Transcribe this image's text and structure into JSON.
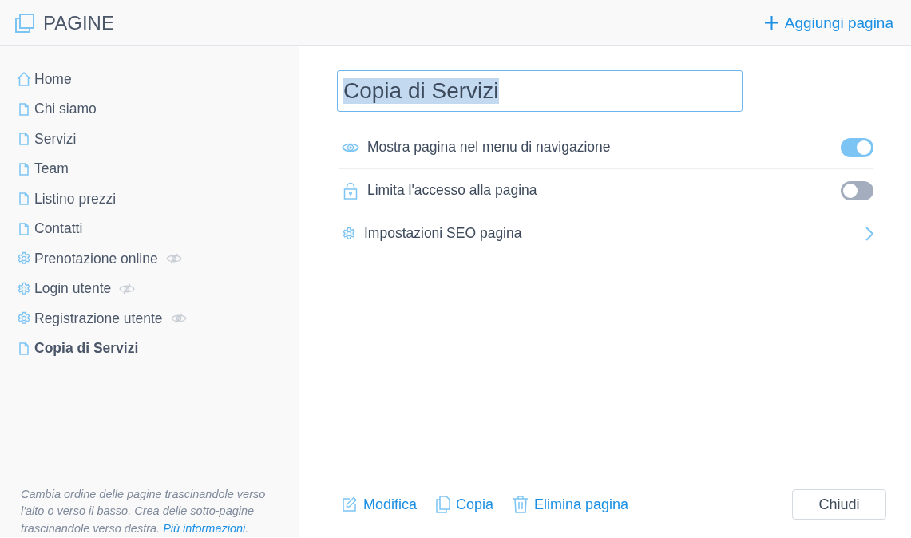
{
  "header": {
    "title": "PAGINE",
    "add_button": "Aggiungi pagina"
  },
  "sidebar": {
    "items": [
      {
        "label": "Home",
        "kind": "home",
        "hidden": false,
        "selected": false
      },
      {
        "label": "Chi siamo",
        "kind": "page",
        "hidden": false,
        "selected": false
      },
      {
        "label": "Servizi",
        "kind": "page",
        "hidden": false,
        "selected": false
      },
      {
        "label": "Team",
        "kind": "page",
        "hidden": false,
        "selected": false
      },
      {
        "label": "Listino prezzi",
        "kind": "page",
        "hidden": false,
        "selected": false
      },
      {
        "label": "Contatti",
        "kind": "page",
        "hidden": false,
        "selected": false
      },
      {
        "label": "Prenotazione online",
        "kind": "system",
        "hidden": true,
        "selected": false
      },
      {
        "label": "Login utente",
        "kind": "system",
        "hidden": true,
        "selected": false
      },
      {
        "label": "Registrazione utente",
        "kind": "system",
        "hidden": true,
        "selected": false
      },
      {
        "label": "Copia di Servizi",
        "kind": "page",
        "hidden": false,
        "selected": true
      }
    ],
    "help": {
      "text": "Cambia ordine delle pagine trascinandole verso l'alto o verso il basso. Crea delle sotto-pagine trascinandole verso destra.",
      "link": "Più informazioni",
      "after": "."
    }
  },
  "editor": {
    "title_field": {
      "value": "Copia di Servizi",
      "text_selected": true
    },
    "settings": [
      {
        "label": "Mostra pagina nel menu di navigazione",
        "kind": "toggle",
        "on": true
      },
      {
        "label": "Limita l'accesso alla pagina",
        "kind": "toggle",
        "on": false
      },
      {
        "label": "Impostazioni SEO pagina",
        "kind": "link"
      }
    ],
    "actions": [
      "Modifica",
      "Copia",
      "Elimina pagina"
    ],
    "close_button": "Chiudi"
  }
}
